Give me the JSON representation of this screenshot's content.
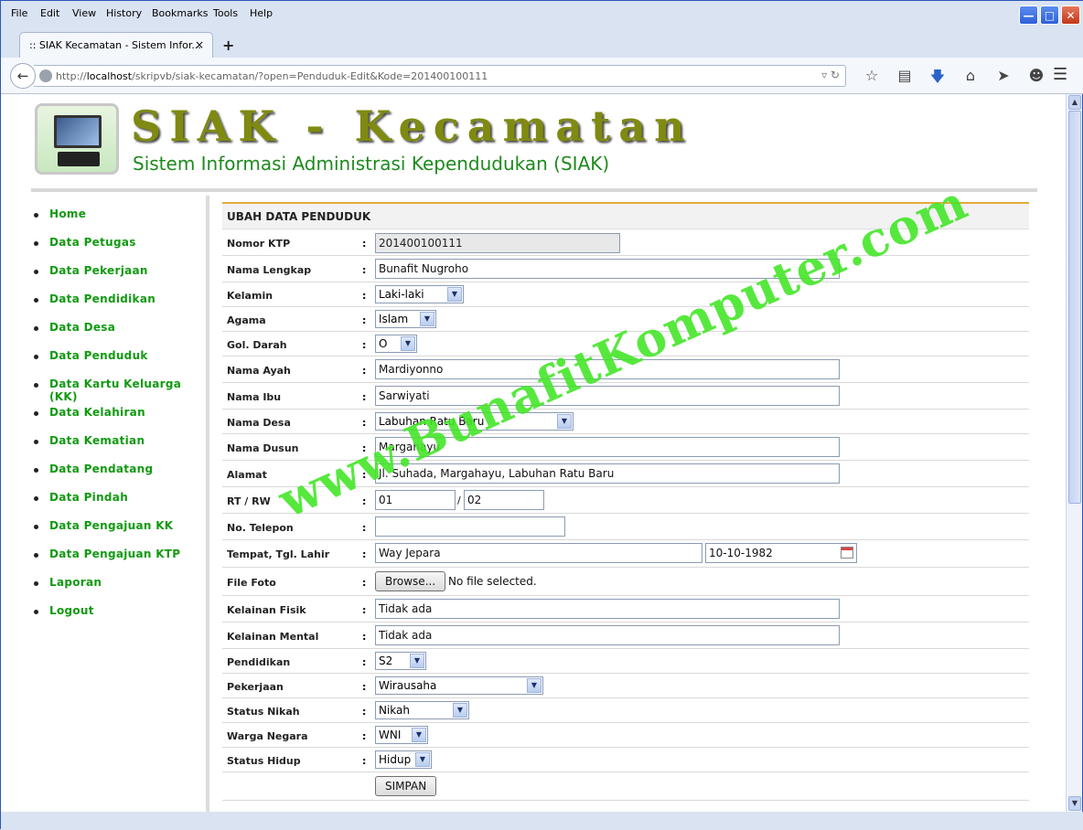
{
  "menubar": {
    "items": [
      "File",
      "Edit",
      "View",
      "History",
      "Bookmarks",
      "Tools",
      "Help"
    ]
  },
  "tab": {
    "title": ":: SIAK Kecamatan - Sistem Infor...",
    "close_icon": "×",
    "new_tab_icon": "+"
  },
  "navbar": {
    "url_prefix": "http://",
    "url_host": "localhost",
    "url_path": "/skripvb/siak-kecamatan/?open=Penduduk-Edit&Kode=201400100111",
    "icons": [
      "star-icon",
      "reading-list-icon",
      "download-icon",
      "home-icon",
      "send-icon",
      "chat-icon",
      "menu-icon"
    ]
  },
  "header": {
    "title": "SIAK - Kecamatan",
    "subtitle": "Sistem Informasi Administrasi Kependudukan (SIAK)"
  },
  "sidebar": {
    "items": [
      "Home",
      "Data Petugas",
      "Data Pekerjaan",
      "Data Pendidikan",
      "Data Desa",
      "Data Penduduk",
      "Data Kartu Keluarga (KK)",
      "Data Kelahiran",
      "Data Kematian",
      "Data Pendatang",
      "Data Pindah",
      "Data Pengajuan KK",
      "Data Pengajuan KTP",
      "Laporan",
      "Logout"
    ]
  },
  "form": {
    "heading": "UBAH DATA PENDUDUK",
    "colon": ":",
    "nomor_ktp": {
      "label": "Nomor KTP",
      "value": "201400100111"
    },
    "nama_lengkap": {
      "label": "Nama Lengkap",
      "value": "Bunafit Nugroho"
    },
    "kelamin": {
      "label": "Kelamin",
      "value": "Laki-laki"
    },
    "agama": {
      "label": "Agama",
      "value": "Islam"
    },
    "gol_darah": {
      "label": "Gol. Darah",
      "value": "O"
    },
    "nama_ayah": {
      "label": "Nama Ayah",
      "value": "Mardiyonno"
    },
    "nama_ibu": {
      "label": "Nama Ibu",
      "value": "Sarwiyati"
    },
    "nama_desa": {
      "label": "Nama Desa",
      "value": "Labuhan Ratu Baru"
    },
    "nama_dusun": {
      "label": "Nama Dusun",
      "value": "Margahayu"
    },
    "alamat": {
      "label": "Alamat",
      "value": "Jl. Suhada, Margahayu, Labuhan Ratu Baru"
    },
    "rt_rw": {
      "label": "RT / RW",
      "rt": "01",
      "sep": "/",
      "rw": "02"
    },
    "telepon": {
      "label": "No. Telepon",
      "value": ""
    },
    "ttl": {
      "label": "Tempat, Tgl. Lahir",
      "tempat": "Way Jepara",
      "tanggal": "10-10-1982"
    },
    "foto": {
      "label": "File Foto",
      "button": "Browse...",
      "status": "No file selected."
    },
    "kelainan_fisik": {
      "label": "Kelainan Fisik",
      "value": "Tidak ada"
    },
    "kelainan_mental": {
      "label": "Kelainan Mental",
      "value": "Tidak ada"
    },
    "pendidikan": {
      "label": "Pendidikan",
      "value": "S2"
    },
    "pekerjaan": {
      "label": "Pekerjaan",
      "value": "Wirausaha"
    },
    "status_nikah": {
      "label": "Status Nikah",
      "value": "Nikah"
    },
    "warga_negara": {
      "label": "Warga Negara",
      "value": "WNI"
    },
    "status_hidup": {
      "label": "Status Hidup",
      "value": "Hidup"
    },
    "submit": "SIMPAN"
  },
  "watermark": "www.BunafitKomputer.com"
}
